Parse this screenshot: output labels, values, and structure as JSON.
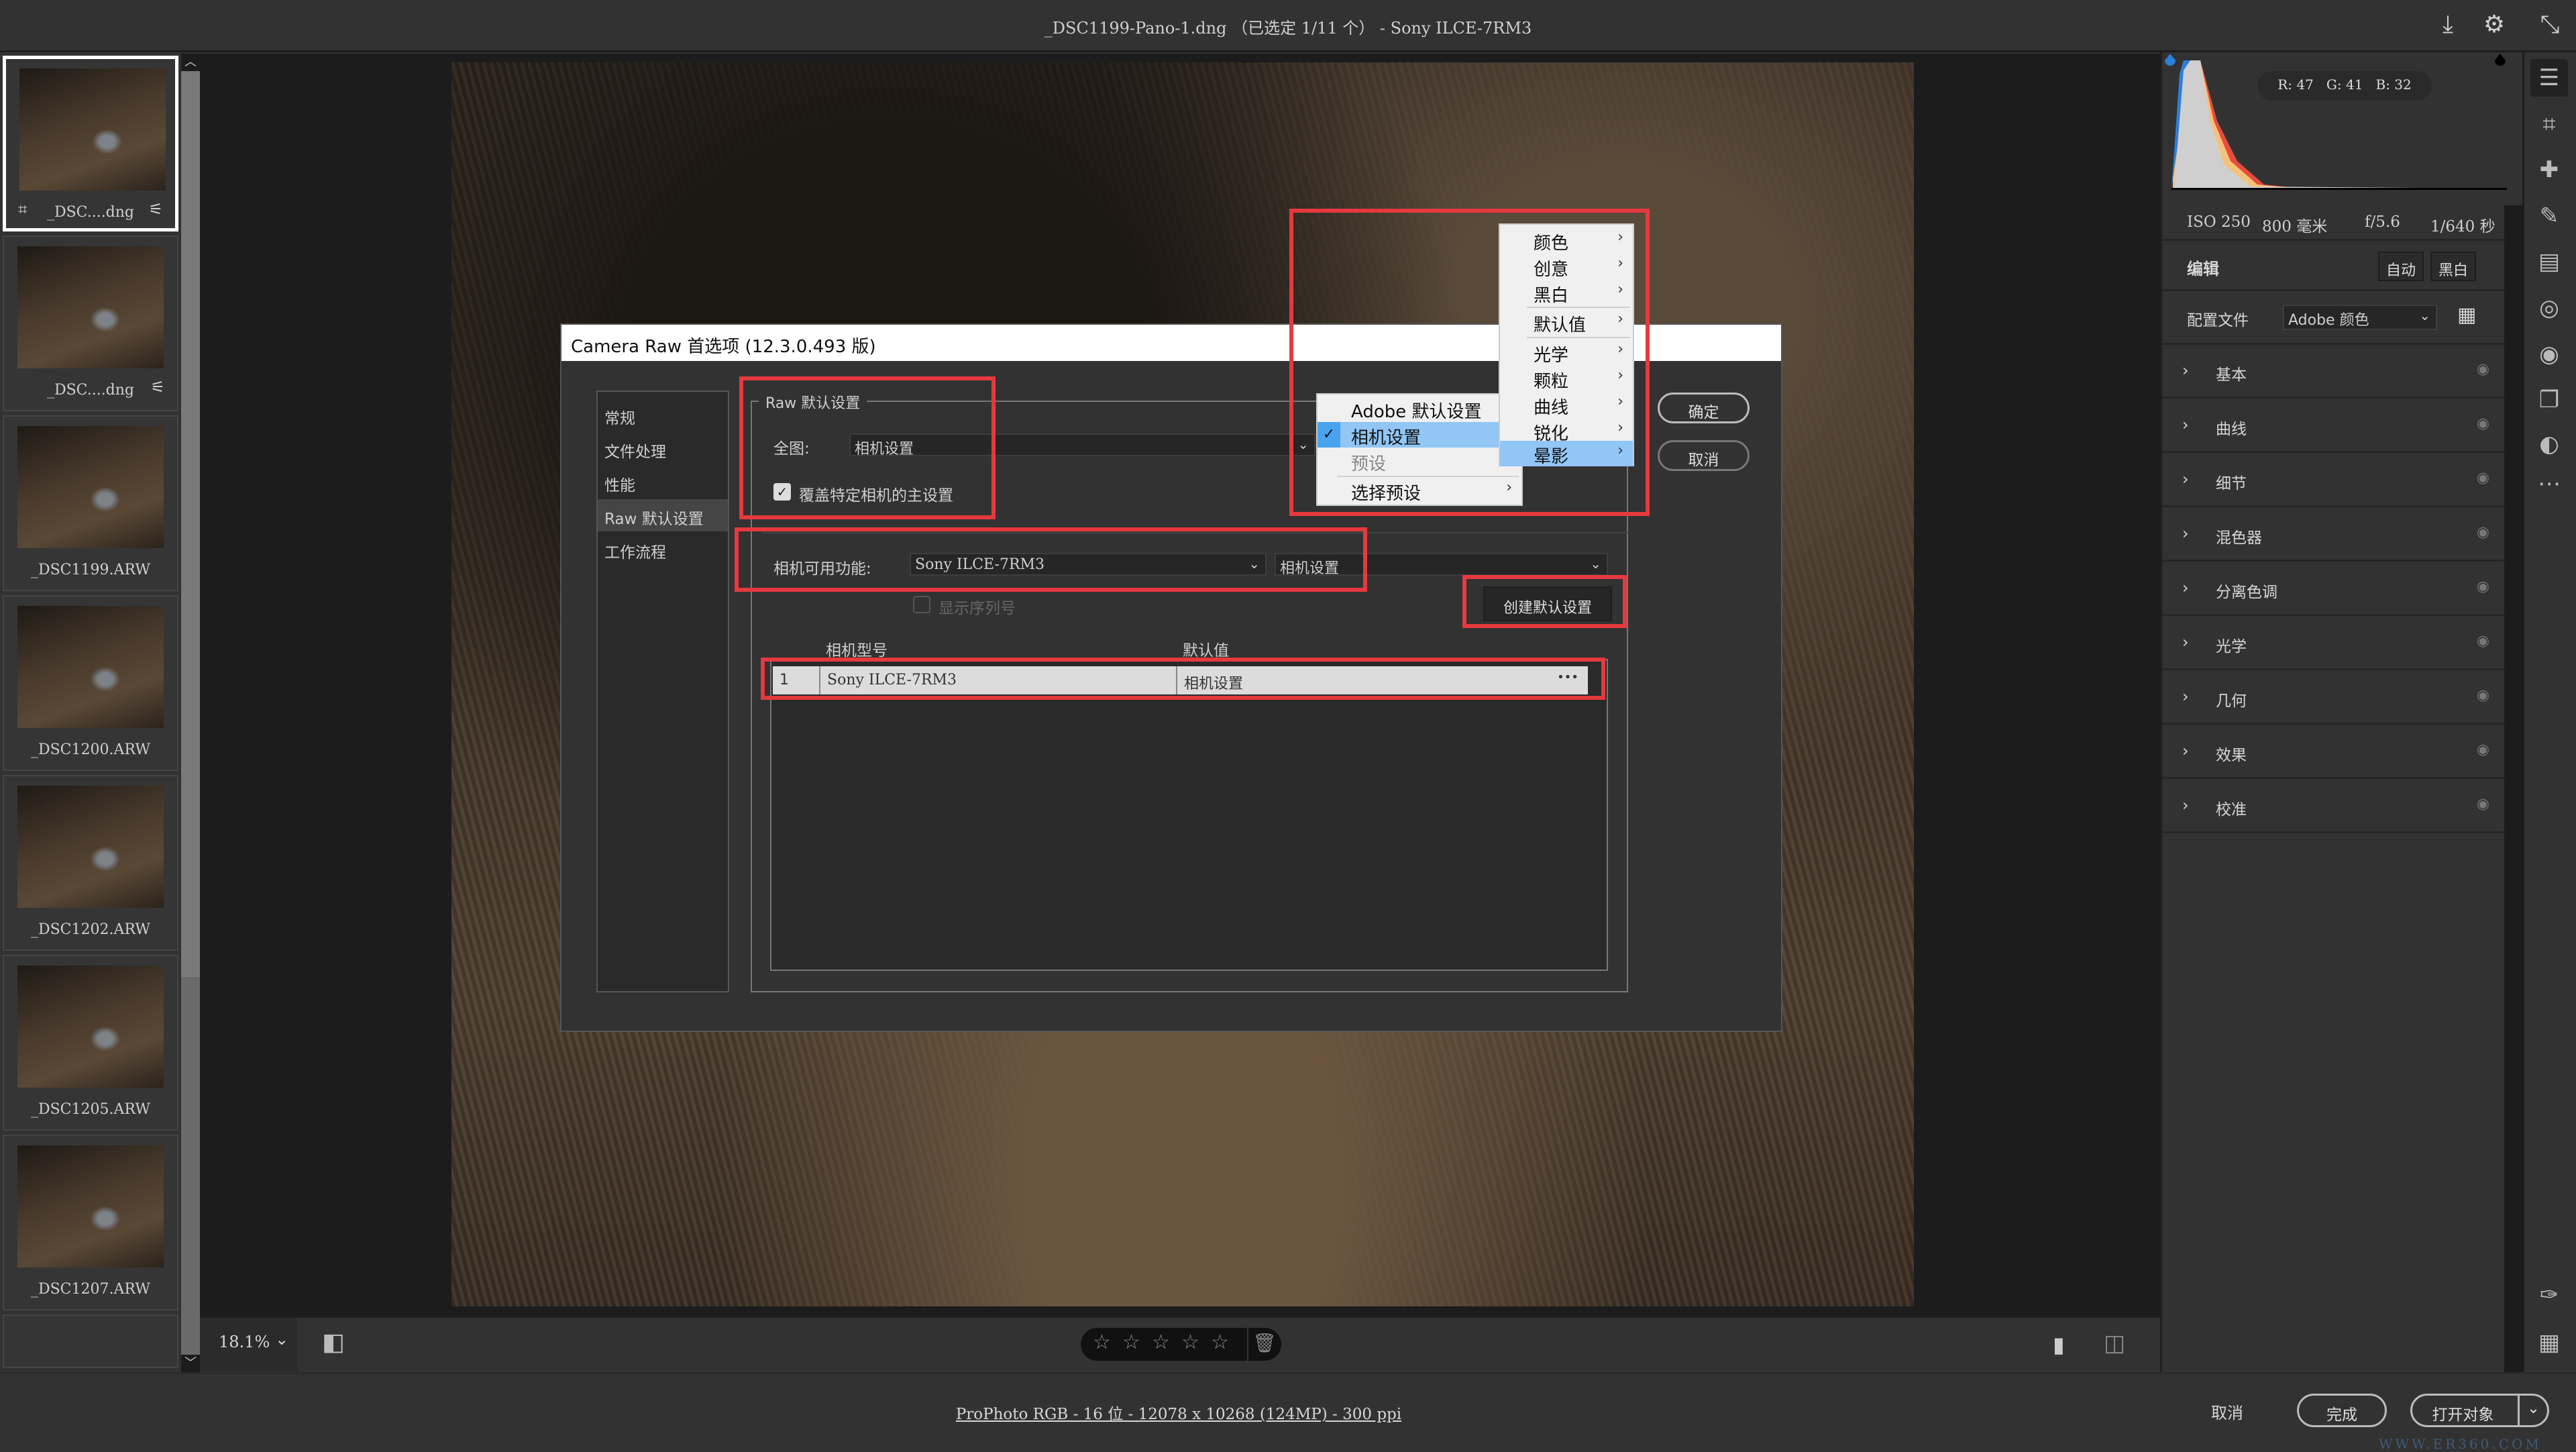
{
  "window": {
    "title": "_DSC1199-Pano-1.dng （已选定 1/11 个） -  Sony ILCE-7RM3",
    "icons": [
      "save-icon",
      "gear-icon",
      "fullscreen-icon"
    ]
  },
  "filmstrip": {
    "items": [
      {
        "label": "_DSC....dng",
        "selected": true,
        "crop": true,
        "adjusted": true
      },
      {
        "label": "_DSC....dng",
        "selected": false,
        "crop": false,
        "adjusted": true
      },
      {
        "label": "_DSC1199.ARW"
      },
      {
        "label": "_DSC1200.ARW"
      },
      {
        "label": "_DSC1202.ARW"
      },
      {
        "label": "_DSC1205.ARW"
      },
      {
        "label": "_DSC1207.ARW"
      }
    ]
  },
  "dialog": {
    "title": "Camera Raw 首选项 (12.3.0.493 版)",
    "nav": [
      "常规",
      "文件处理",
      "性能",
      "Raw 默认设置",
      "工作流程"
    ],
    "nav_selected": 3,
    "group_title": "Raw 默认设置",
    "global_label": "全图:",
    "global_value": "相机设置",
    "override_label": "覆盖特定相机的主设置",
    "override_checked": true,
    "camera_label": "相机可用功能:",
    "camera_value": "Sony ILCE-7RM3",
    "camera_default_value": "相机设置",
    "show_serial_label": "显示序列号",
    "show_serial_checked": false,
    "create_default_label": "创建默认设置",
    "table": {
      "headers": [
        "相机型号",
        "默认值"
      ],
      "rows": [
        {
          "index": "1",
          "model": "Sony ILCE-7RM3",
          "default": "相机设置",
          "more": "•••"
        }
      ]
    },
    "ok_label": "确定",
    "cancel_label": "取消"
  },
  "menu_primary": {
    "items": [
      {
        "label": "Adobe 默认设置"
      },
      {
        "label": "相机设置",
        "checked": true,
        "highlighted": true
      },
      {
        "label": "预设",
        "disabled": true
      },
      {
        "label": "选择预设",
        "submenu": true
      }
    ]
  },
  "menu_presets": {
    "items": [
      {
        "label": "颜色"
      },
      {
        "label": "创意"
      },
      {
        "label": "黑白"
      },
      {
        "label": "默认值"
      },
      {
        "label": "光学"
      },
      {
        "label": "颗粒"
      },
      {
        "label": "曲线"
      },
      {
        "label": "锐化"
      },
      {
        "label": "晕影",
        "highlighted": true
      }
    ]
  },
  "annotation_color": "#e5393f",
  "bottom": {
    "zoom": "18.1%",
    "rating": 0,
    "rating_max": 5,
    "status": "ProPhoto RGB - 16 位 - 12078 x 10268 (124MP) - 300 ppi",
    "cancel_label": "取消",
    "done_label": "完成",
    "open_label": "打开对象",
    "watermark": "WWW.ER360.COM"
  },
  "right": {
    "rgb": {
      "r": "R: 47",
      "g": "G: 41",
      "b": "B: 32"
    },
    "exif": {
      "iso": "ISO 250",
      "focal": "800 毫米",
      "aperture": "f/5.6",
      "shutter": "1/640 秒"
    },
    "edit_label": "编辑",
    "auto_label": "自动",
    "bw_label": "黑白",
    "profile_label": "配置文件",
    "profile_value": "Adobe 颜色",
    "sections": [
      "基本",
      "曲线",
      "细节",
      "混色器",
      "分离色调",
      "光学",
      "几何",
      "效果",
      "校准"
    ]
  },
  "tools": [
    "edit-sliders-icon",
    "crop-icon",
    "healing-icon",
    "brush-icon",
    "gradient-icon",
    "radial-icon",
    "redeye-icon",
    "presets-icon",
    "snapshots-icon",
    "more-icon",
    "color-sampler-icon",
    "grid-icon"
  ]
}
